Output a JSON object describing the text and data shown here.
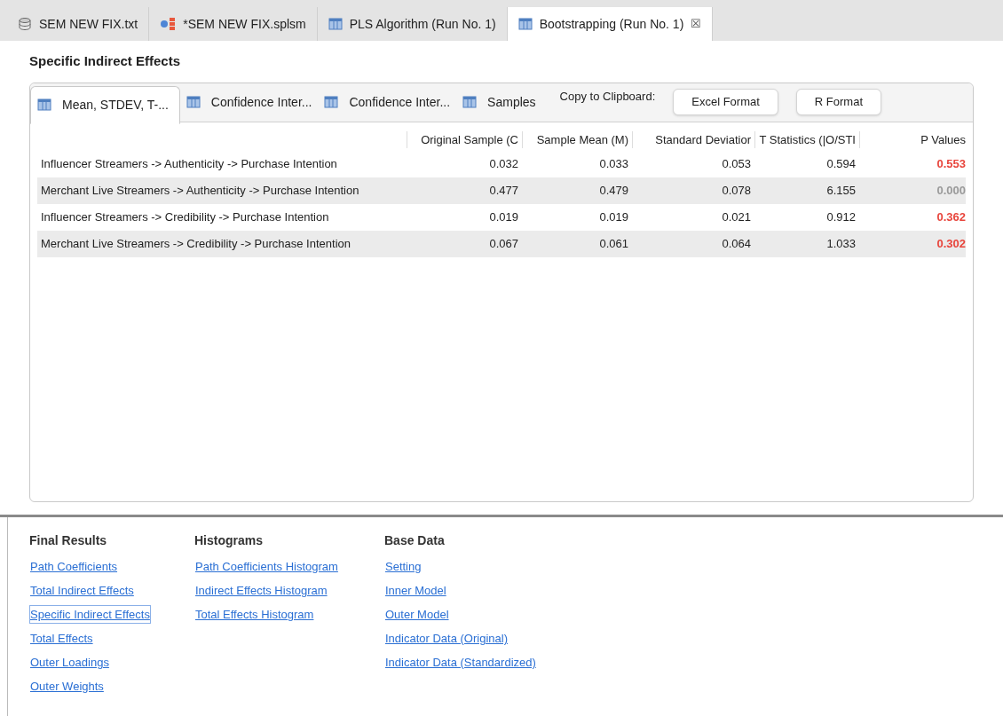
{
  "editor_tabs": [
    {
      "label": "SEM NEW FIX.txt",
      "kind": "database",
      "selected": false
    },
    {
      "label": "*SEM NEW FIX.splsm",
      "kind": "model",
      "selected": false
    },
    {
      "label": "PLS Algorithm (Run No. 1)",
      "kind": "table",
      "selected": false
    },
    {
      "label": "Bootstrapping (Run No. 1)",
      "kind": "table",
      "selected": true,
      "close": "☒"
    }
  ],
  "title": "Specific Indirect Effects",
  "result_tabs": [
    {
      "label": "Mean, STDEV, T-...",
      "selected": true
    },
    {
      "label": "Confidence Inter...",
      "selected": false
    },
    {
      "label": "Confidence Inter...",
      "selected": false
    },
    {
      "label": "Samples",
      "selected": false
    }
  ],
  "clipboard": {
    "label": "Copy to Clipboard:",
    "buttons": [
      "Excel Format",
      "R Format"
    ]
  },
  "table": {
    "columns": [
      "Original Sample (C",
      "Sample Mean (M)",
      "Standard Deviatior",
      "T Statistics (|O/STI",
      "P Values"
    ],
    "rows": [
      {
        "name": "Influencer Streamers -> Authenticity -> Purchase Intention",
        "values": [
          "0.032",
          "0.033",
          "0.053",
          "0.594"
        ],
        "p": "0.553",
        "color": "#e8453c"
      },
      {
        "name": "Merchant Live Streamers -> Authenticity -> Purchase Intention",
        "values": [
          "0.477",
          "0.479",
          "0.078",
          "6.155"
        ],
        "p": "0.000",
        "color": "#9a9a9a"
      },
      {
        "name": "Influencer Streamers -> Credibility -> Purchase Intention",
        "values": [
          "0.019",
          "0.019",
          "0.021",
          "0.912"
        ],
        "p": "0.362",
        "color": "#e8453c"
      },
      {
        "name": "Merchant Live Streamers -> Credibility -> Purchase Intention",
        "values": [
          "0.067",
          "0.061",
          "0.064",
          "1.033"
        ],
        "p": "0.302",
        "color": "#e8453c"
      }
    ]
  },
  "link_groups": [
    {
      "heading": "Final Results",
      "links": [
        {
          "label": "Path Coefficients",
          "selected": false
        },
        {
          "label": "Total Indirect Effects",
          "selected": false
        },
        {
          "label": "Specific Indirect Effects",
          "selected": true
        },
        {
          "label": "Total Effects",
          "selected": false
        },
        {
          "label": "Outer Loadings",
          "selected": false
        },
        {
          "label": "Outer Weights",
          "selected": false
        }
      ]
    },
    {
      "heading": "Histograms",
      "links": [
        {
          "label": "Path Coefficients Histogram",
          "selected": false
        },
        {
          "label": "Indirect Effects Histogram",
          "selected": false
        },
        {
          "label": "Total Effects Histogram",
          "selected": false
        }
      ]
    },
    {
      "heading": "Base Data",
      "links": [
        {
          "label": "Setting",
          "selected": false
        },
        {
          "label": "Inner Model",
          "selected": false
        },
        {
          "label": "Outer Model",
          "selected": false
        },
        {
          "label": "Indicator Data (Original)",
          "selected": false
        },
        {
          "label": "Indicator Data (Standardized)",
          "selected": false
        }
      ]
    }
  ]
}
